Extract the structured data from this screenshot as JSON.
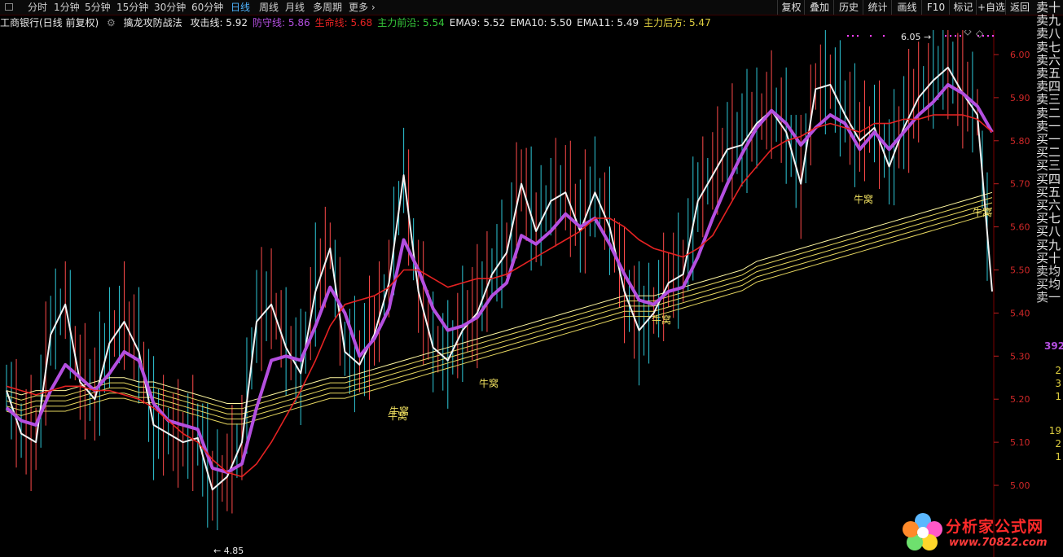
{
  "toolbar": {
    "timeframes": [
      {
        "label": "分时",
        "active": false
      },
      {
        "label": "1分钟",
        "active": false
      },
      {
        "label": "5分钟",
        "active": false
      },
      {
        "label": "15分钟",
        "active": false
      },
      {
        "label": "30分钟",
        "active": false
      },
      {
        "label": "60分钟",
        "active": false
      },
      {
        "label": "日线",
        "active": true
      },
      {
        "label": "周线",
        "active": false
      },
      {
        "label": "月线",
        "active": false
      },
      {
        "label": "多周期",
        "active": false
      },
      {
        "label": "更多",
        "active": false
      }
    ],
    "buttons": [
      "复权",
      "叠加",
      "历史",
      "统计",
      "画线",
      "F10",
      "标记",
      "+自选",
      "返回"
    ]
  },
  "info": {
    "stock": "工商银行(日线 前复权)",
    "indicator": "擒龙攻防战法",
    "items": [
      {
        "label": "攻击线",
        "value": "5.92",
        "color": "#e8e8e8"
      },
      {
        "label": "防守线",
        "value": "5.86",
        "color": "#b44fe0"
      },
      {
        "label": "生命线",
        "value": "5.68",
        "color": "#e52222"
      },
      {
        "label": "主力前沿",
        "value": "5.54",
        "color": "#36c83a"
      },
      {
        "label": "EMA9",
        "value": "5.52",
        "color": "#e8e8e8"
      },
      {
        "label": "EMA10",
        "value": "5.50",
        "color": "#e8e8e8"
      },
      {
        "label": "EMA11",
        "value": "5.49",
        "color": "#e8e8e8"
      },
      {
        "label": "主力后方",
        "value": "5.47",
        "color": "#e0d040"
      }
    ]
  },
  "orderbook": {
    "sell": [
      "卖十",
      "卖九",
      "卖八",
      "卖七",
      "卖六",
      "卖五",
      "卖四",
      "卖三",
      "卖二",
      "卖一"
    ],
    "buy": [
      "买一",
      "买二",
      "买三",
      "买四",
      "买五",
      "买六",
      "买七",
      "买八",
      "买九",
      "买十"
    ],
    "avg": [
      "卖均",
      "买均"
    ],
    "tail": "卖一",
    "number": "392",
    "small": [
      "2",
      "3",
      "1",
      "19",
      "2",
      "1"
    ]
  },
  "chart_data": {
    "type": "line",
    "ylim": [
      4.85,
      6.07
    ],
    "y_ticks": [
      "6.00",
      "5.90",
      "5.80",
      "5.70",
      "5.60",
      "5.50",
      "5.40",
      "5.30",
      "5.20",
      "5.10",
      "5.00"
    ],
    "high_label": "6.05",
    "low_label": "4.85",
    "series": [
      {
        "name": "攻击线",
        "color": "#f2f2f2",
        "values": [
          5.22,
          5.12,
          5.1,
          5.35,
          5.42,
          5.24,
          5.2,
          5.33,
          5.38,
          5.31,
          5.14,
          5.12,
          5.1,
          5.11,
          4.99,
          5.02,
          5.1,
          5.38,
          5.42,
          5.32,
          5.26,
          5.45,
          5.55,
          5.31,
          5.28,
          5.35,
          5.47,
          5.72,
          5.45,
          5.32,
          5.29,
          5.36,
          5.4,
          5.49,
          5.54,
          5.7,
          5.59,
          5.66,
          5.68,
          5.59,
          5.68,
          5.6,
          5.45,
          5.36,
          5.4,
          5.47,
          5.49,
          5.66,
          5.72,
          5.78,
          5.79,
          5.84,
          5.87,
          5.82,
          5.7,
          5.92,
          5.93,
          5.86,
          5.8,
          5.83,
          5.74,
          5.83,
          5.9,
          5.94,
          5.97,
          5.91,
          5.86,
          5.45
        ]
      },
      {
        "name": "防守线",
        "color": "#b44fe0",
        "values": [
          5.18,
          5.15,
          5.14,
          5.22,
          5.28,
          5.25,
          5.22,
          5.26,
          5.31,
          5.29,
          5.19,
          5.15,
          5.14,
          5.13,
          5.04,
          5.03,
          5.05,
          5.18,
          5.29,
          5.3,
          5.29,
          5.37,
          5.46,
          5.4,
          5.3,
          5.34,
          5.41,
          5.57,
          5.5,
          5.41,
          5.36,
          5.37,
          5.39,
          5.44,
          5.47,
          5.58,
          5.56,
          5.59,
          5.63,
          5.6,
          5.62,
          5.56,
          5.49,
          5.43,
          5.42,
          5.45,
          5.46,
          5.53,
          5.62,
          5.7,
          5.77,
          5.83,
          5.87,
          5.84,
          5.79,
          5.83,
          5.86,
          5.84,
          5.78,
          5.82,
          5.78,
          5.82,
          5.86,
          5.89,
          5.93,
          5.91,
          5.88,
          5.82
        ]
      },
      {
        "name": "生命线",
        "color": "#e52222",
        "values": [
          5.23,
          5.22,
          5.21,
          5.22,
          5.23,
          5.23,
          5.22,
          5.22,
          5.21,
          5.2,
          5.18,
          5.15,
          5.12,
          5.1,
          5.06,
          5.03,
          5.02,
          5.05,
          5.1,
          5.16,
          5.22,
          5.29,
          5.37,
          5.42,
          5.43,
          5.44,
          5.46,
          5.5,
          5.5,
          5.48,
          5.46,
          5.47,
          5.48,
          5.48,
          5.49,
          5.51,
          5.53,
          5.55,
          5.57,
          5.59,
          5.62,
          5.62,
          5.6,
          5.57,
          5.55,
          5.54,
          5.53,
          5.55,
          5.58,
          5.64,
          5.7,
          5.74,
          5.78,
          5.8,
          5.81,
          5.83,
          5.84,
          5.83,
          5.82,
          5.84,
          5.84,
          5.85,
          5.85,
          5.86,
          5.86,
          5.86,
          5.85,
          5.82
        ]
      }
    ],
    "ribbon": {
      "name": "主力前沿",
      "values": [
        5.2,
        5.19,
        5.2,
        5.2,
        5.2,
        5.21,
        5.22,
        5.23,
        5.23,
        5.22,
        5.22,
        5.21,
        5.2,
        5.19,
        5.18,
        5.17,
        5.17,
        5.18,
        5.19,
        5.2,
        5.21,
        5.22,
        5.23,
        5.23,
        5.24,
        5.25,
        5.26,
        5.27,
        5.28,
        5.29,
        5.3,
        5.31,
        5.32,
        5.33,
        5.34,
        5.35,
        5.36,
        5.37,
        5.38,
        5.39,
        5.4,
        5.41,
        5.42,
        5.42,
        5.42,
        5.43,
        5.44,
        5.45,
        5.46,
        5.47,
        5.48,
        5.5,
        5.51,
        5.52,
        5.53,
        5.54,
        5.55,
        5.56,
        5.57,
        5.58,
        5.59,
        5.6,
        5.61,
        5.62,
        5.63,
        5.64,
        5.65,
        5.66
      ]
    },
    "annotations": [
      "牛窝",
      "牛窝",
      "牛窝",
      "牛窝",
      "牛窝",
      "牛窝"
    ]
  }
}
